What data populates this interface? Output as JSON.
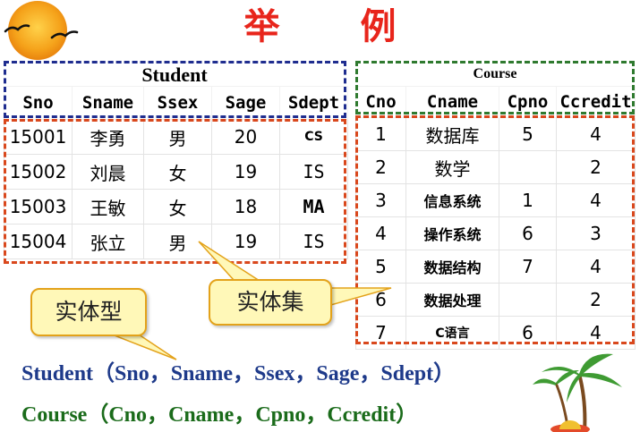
{
  "slide": {
    "title": "举 例"
  },
  "student": {
    "table_name": "Student",
    "headers": [
      "Sno",
      "Sname",
      "Ssex",
      "Sage",
      "Sdept"
    ],
    "rows": [
      [
        "15001",
        "李勇",
        "男",
        "20",
        "CS"
      ],
      [
        "15002",
        "刘晨",
        "女",
        "19",
        "IS"
      ],
      [
        "15003",
        "王敏",
        "女",
        "18",
        "MA"
      ],
      [
        "15004",
        "张立",
        "男",
        "19",
        "IS"
      ]
    ]
  },
  "course": {
    "table_name": "Course",
    "headers": [
      "Cno",
      "Cname",
      "Cpno",
      "Ccredit"
    ],
    "rows": [
      [
        "1",
        "数据库",
        "5",
        "4"
      ],
      [
        "2",
        "数学",
        "",
        "2"
      ],
      [
        "3",
        "信息系统",
        "1",
        "4"
      ],
      [
        "4",
        "操作系统",
        "6",
        "3"
      ],
      [
        "5",
        "数据结构",
        "7",
        "4"
      ],
      [
        "6",
        "数据处理",
        "",
        "2"
      ],
      [
        "7",
        "C语言",
        "6",
        "4"
      ]
    ]
  },
  "callouts": {
    "entity_type": "实体型",
    "entity_set": "实体集"
  },
  "schemas": {
    "student_schema": "Student（Sno，Sname，Ssex，Sage，Sdept）",
    "course_schema": "Course（Cno，Cname，Cpno，Ccredit）"
  },
  "colors": {
    "title": "#e8251b",
    "blue_box": "#1f2d8f",
    "orange_box": "#d9481d",
    "green_box": "#2f7a2f",
    "callout_fill": "#fff8b8",
    "schema_blue": "#1e3a8a",
    "schema_green": "#1a6b1a"
  },
  "icons": {
    "sun": "sun-icon",
    "birds": "birds-icon",
    "palm": "palm-tree-icon"
  }
}
